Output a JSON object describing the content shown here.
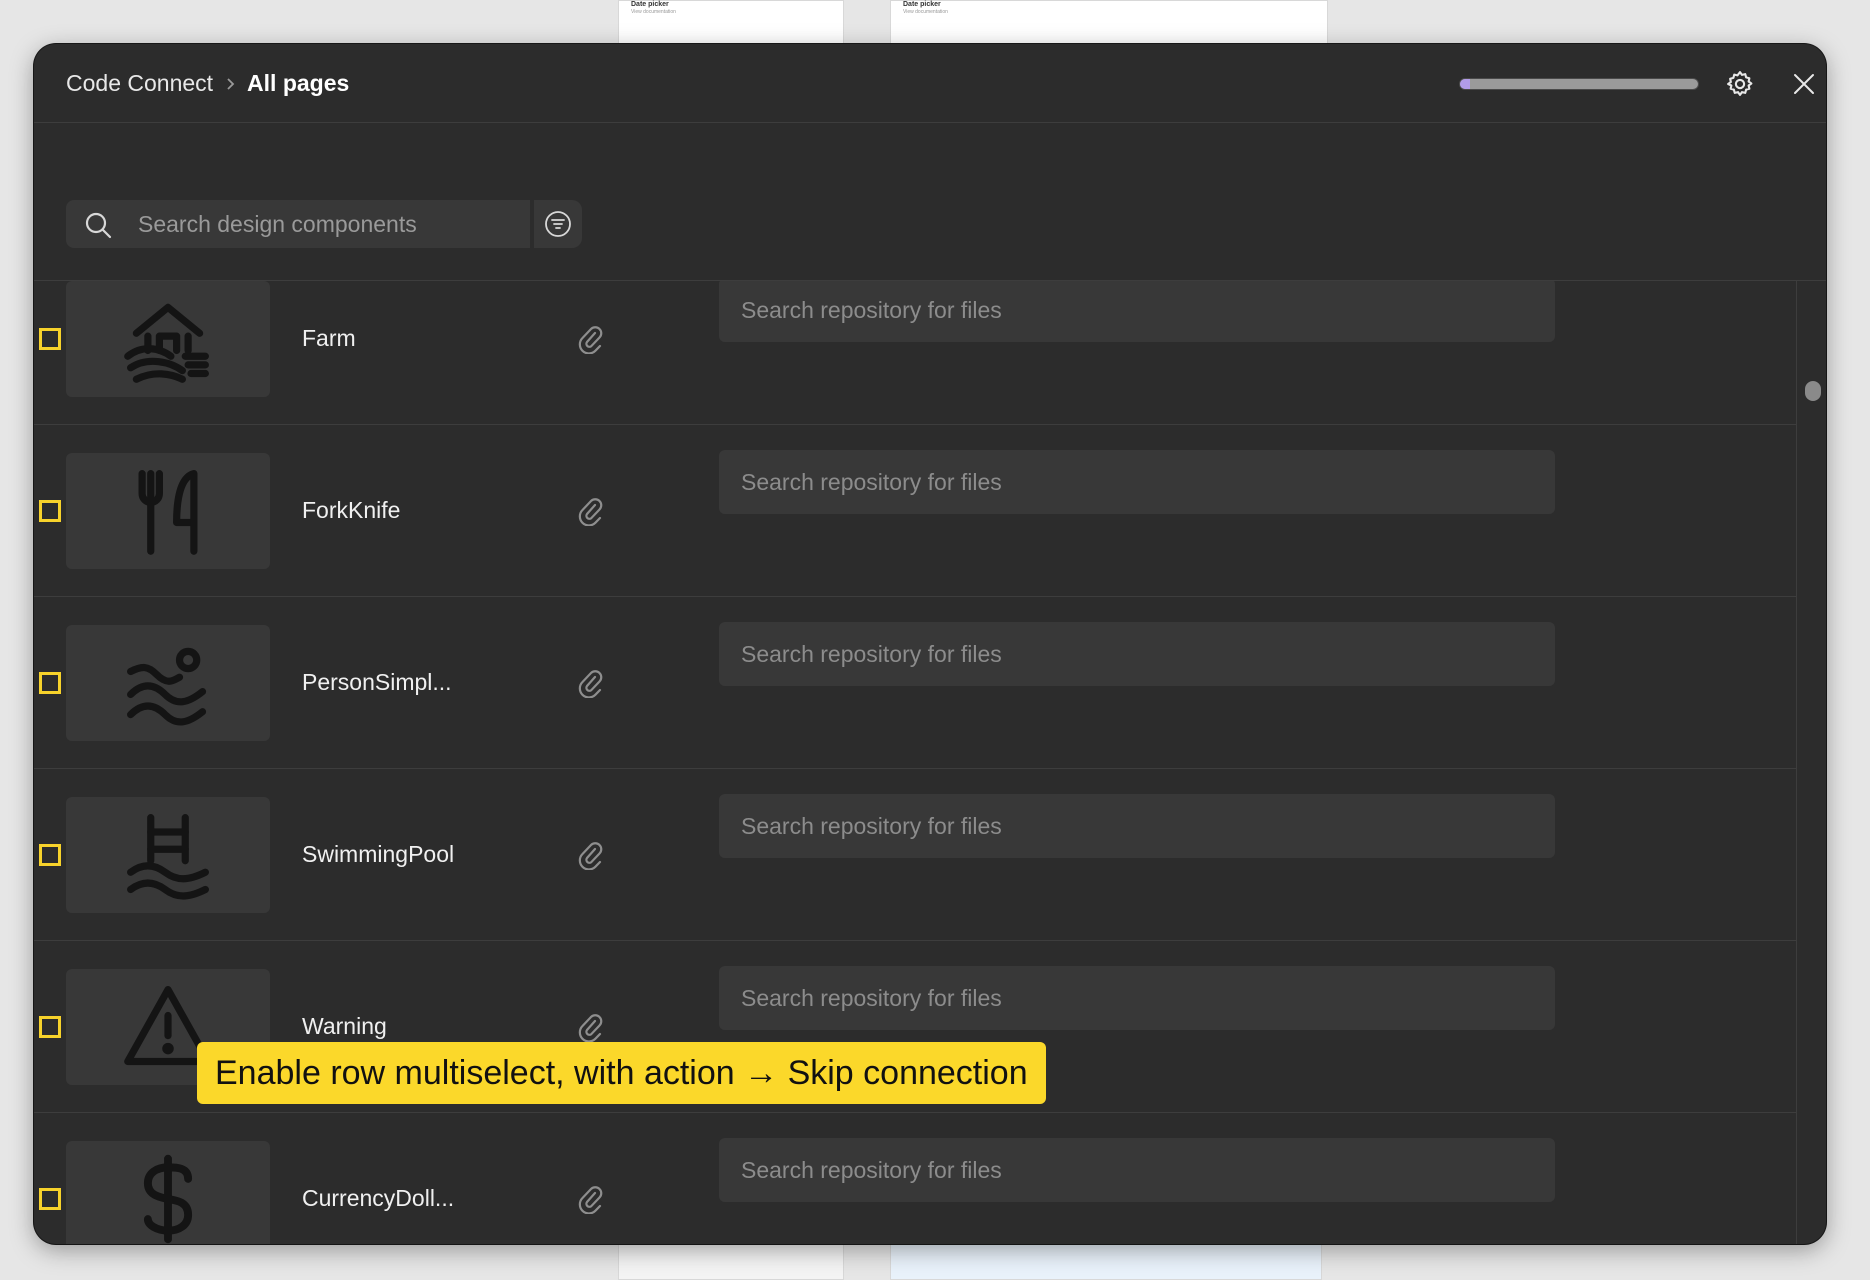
{
  "background_cards": {
    "top_left": {
      "title": "Date picker",
      "subtitle": "View documentation"
    },
    "top_right": {
      "title": "Date picker",
      "subtitle": "View documentation"
    }
  },
  "header": {
    "breadcrumb_root": "Code Connect",
    "breadcrumb_current": "All pages",
    "progress": 0.04
  },
  "search": {
    "placeholder": "Search design components"
  },
  "rows": [
    {
      "name": "Farm",
      "icon": "farm-icon",
      "file_placeholder": "Search repository for files"
    },
    {
      "name": "ForkKnife",
      "icon": "fork-knife-icon",
      "file_placeholder": "Search repository for files"
    },
    {
      "name": "PersonSimpl...",
      "icon": "person-simple-swim-icon",
      "file_placeholder": "Search repository for files"
    },
    {
      "name": "SwimmingPool",
      "icon": "swimming-pool-icon",
      "file_placeholder": "Search repository for files"
    },
    {
      "name": "Warning",
      "icon": "warning-icon",
      "file_placeholder": "Search repository for files"
    },
    {
      "name": "CurrencyDoll...",
      "icon": "currency-dollar-icon",
      "file_placeholder": "Search repository for files"
    }
  ],
  "annotation": {
    "text": "Enable row multiselect, with action → Skip connection"
  },
  "colors": {
    "modal_bg": "#2c2c2c",
    "panel_bg": "#383838",
    "checkbox": "#f7d22b",
    "annotation_bg": "#fbd82a",
    "progress_fill": "#b29ce8"
  }
}
